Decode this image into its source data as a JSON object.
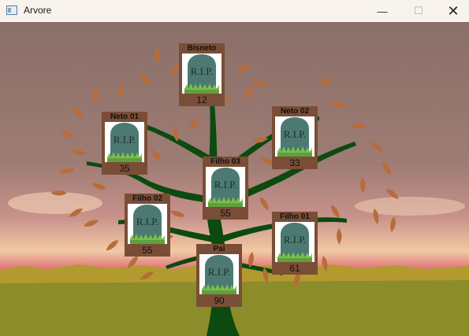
{
  "window": {
    "title": "Arvore",
    "controls": {
      "minimize": "—",
      "maximize": "☐",
      "close": "✕"
    }
  },
  "tombstone_text": "R.I.P.",
  "members": [
    {
      "name": "Bisneto",
      "age": "12"
    },
    {
      "name": "Neto 01",
      "age": "35"
    },
    {
      "name": "Neto 02",
      "age": "33"
    },
    {
      "name": "Filho 03",
      "age": "55"
    },
    {
      "name": "Filho 02",
      "age": "55"
    },
    {
      "name": "Filho 01",
      "age": "61"
    },
    {
      "name": "Pai",
      "age": "90"
    }
  ],
  "colors": {
    "sky_top": "#8a6f68",
    "sky_mid": "#c7928a",
    "horizon": "#e27d7f",
    "grass": "#8a8a2a",
    "trunk": "#0c4a10",
    "leaf": "#b86c3a",
    "card_frame": "#7a4e36",
    "tombstone": "#4c7a72"
  }
}
